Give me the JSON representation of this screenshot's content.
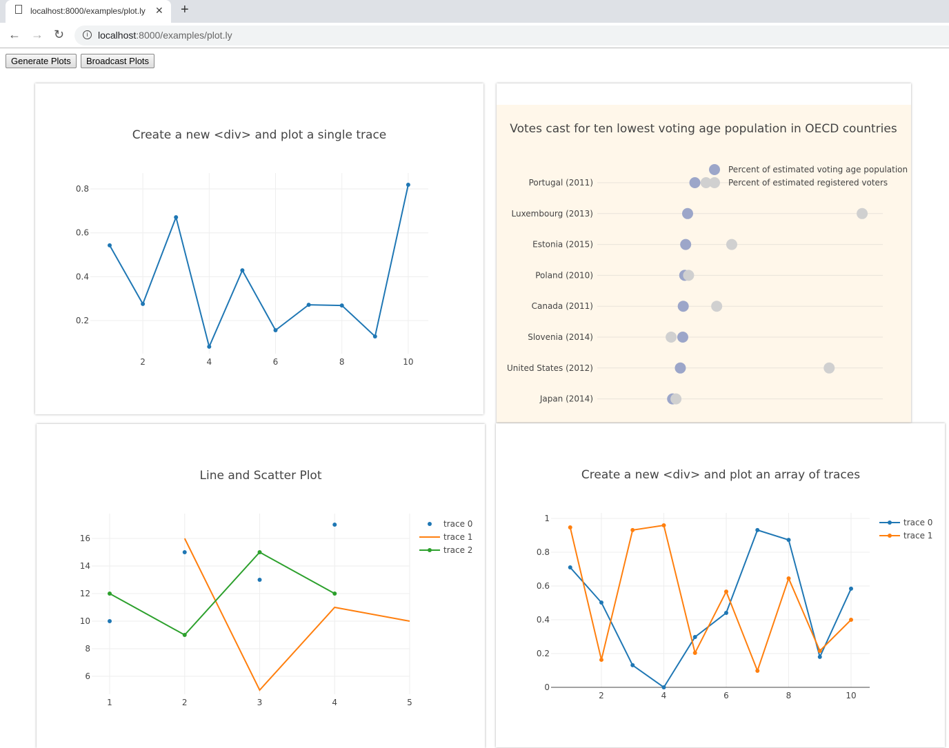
{
  "browser": {
    "tab_title": "localhost:8000/examples/plot.ly",
    "url_host": "localhost",
    "url_path": ":8000/examples/plot.ly"
  },
  "toolbar": {
    "generate_label": "Generate Plots",
    "broadcast_label": "Broadcast Plots"
  },
  "chart_data": [
    {
      "type": "line",
      "title": "Create a new <div> and plot a single trace",
      "x": [
        1,
        2,
        3,
        4,
        5,
        6,
        7,
        8,
        9,
        10
      ],
      "series": [
        {
          "values": [
            0.543,
            0.276,
            0.671,
            0.081,
            0.429,
            0.156,
            0.272,
            0.269,
            0.128,
            0.819
          ],
          "color": "#1f77b4"
        }
      ],
      "xticks": [
        2,
        4,
        6,
        8,
        10
      ],
      "yticks": [
        0.2,
        0.4,
        0.6,
        0.8
      ],
      "grid": true
    },
    {
      "type": "scatter",
      "title": "Votes cast for ten lowest voting age population in OECD countries",
      "categories": [
        "Portugal (2011)",
        "Luxembourg (2013)",
        "Estonia (2015)",
        "Poland (2010)",
        "Canada (2011)",
        "Slovenia (2014)",
        "United States (2012)",
        "Japan (2014)"
      ],
      "series": [
        {
          "name": "Percent of estimated voting age population",
          "values": [
            56.6,
            55.1,
            54.7,
            54.5,
            54.2,
            54.1,
            53.6,
            52
          ],
          "color": "#9ca6c9"
        },
        {
          "name": "Percent of estimated registered voters",
          "values": [
            58.9,
            91.1,
            64.2,
            55.3,
            61.1,
            51.7,
            84.3,
            52.7
          ],
          "color": "#d0d0d0"
        }
      ],
      "legend": "top-right",
      "background": "#fff7ea"
    },
    {
      "type": "line",
      "title": "Line and Scatter Plot",
      "series": [
        {
          "name": "trace 0",
          "mode": "markers",
          "x": [
            1,
            2,
            3,
            4
          ],
          "values": [
            10,
            15,
            13,
            17
          ],
          "color": "#1f77b4"
        },
        {
          "name": "trace 1",
          "mode": "lines",
          "x": [
            2,
            3,
            4,
            5
          ],
          "values": [
            16,
            5,
            11,
            10
          ],
          "color": "#ff7f0e"
        },
        {
          "name": "trace 2",
          "mode": "lines+markers",
          "x": [
            1,
            2,
            3,
            4
          ],
          "values": [
            12,
            9,
            15,
            12
          ],
          "color": "#2ca02c"
        }
      ],
      "xticks": [
        1,
        2,
        3,
        4,
        5
      ],
      "yticks": [
        6,
        8,
        10,
        12,
        14,
        16
      ],
      "legend": "top-right",
      "grid": true
    },
    {
      "type": "line",
      "title": "Create a new <div> and plot an array of traces",
      "x": [
        1,
        2,
        3,
        4,
        5,
        6,
        7,
        8,
        9,
        10
      ],
      "series": [
        {
          "name": "trace 0",
          "values": [
            0.71,
            0.502,
            0.131,
            0,
            0.298,
            0.441,
            0.931,
            0.873,
            0.18,
            0.584
          ],
          "color": "#1f77b4"
        },
        {
          "name": "trace 1",
          "values": [
            0.947,
            0.163,
            0.931,
            0.959,
            0.204,
            0.567,
            0.098,
            0.645,
            0.216,
            0.4
          ],
          "color": "#ff7f0e"
        }
      ],
      "xticks": [
        2,
        4,
        6,
        8,
        10
      ],
      "yticks": [
        0,
        0.2,
        0.4,
        0.6,
        0.8,
        1
      ],
      "legend": "top-right",
      "grid": true
    }
  ]
}
